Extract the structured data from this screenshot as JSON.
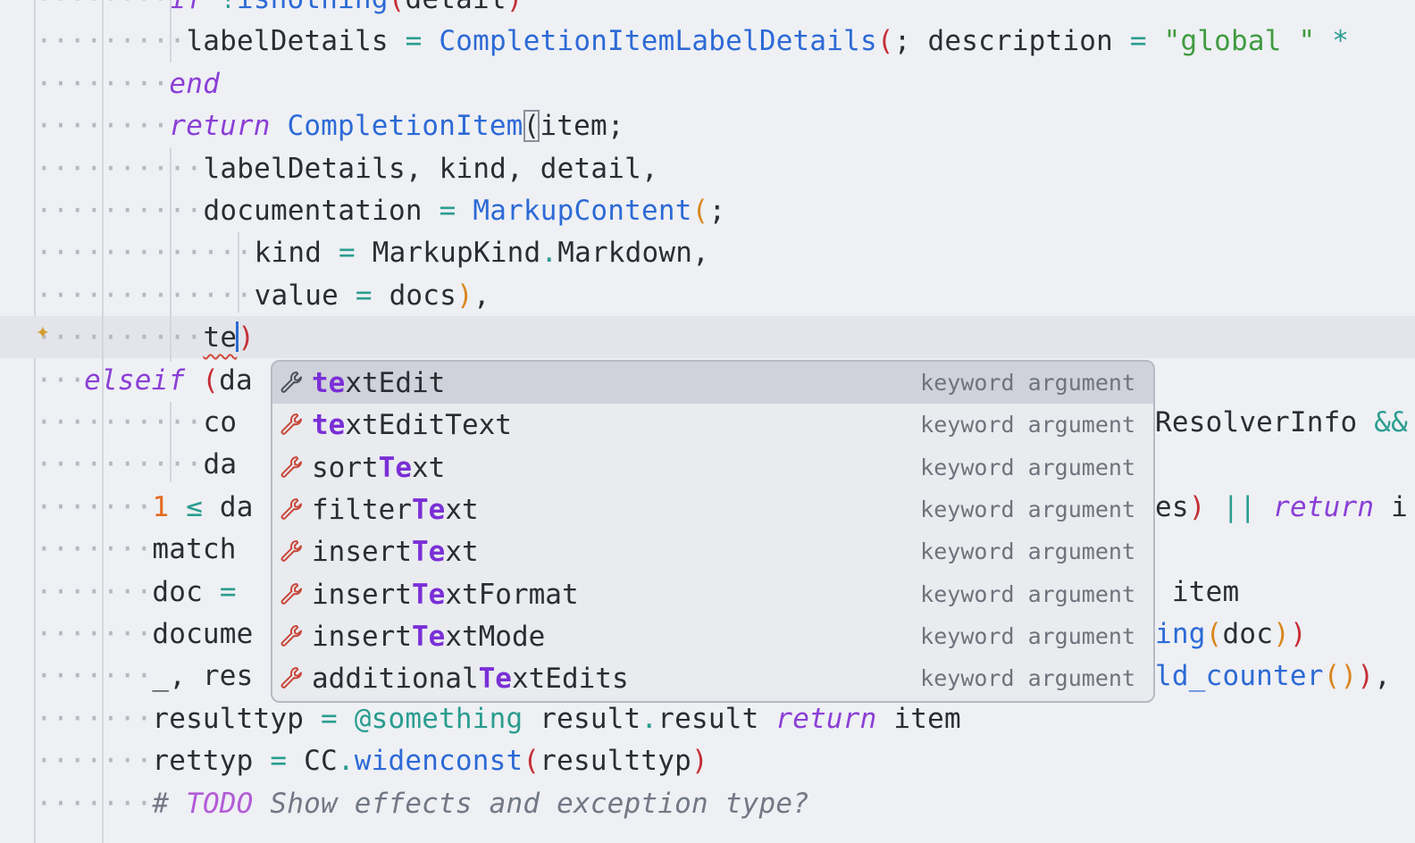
{
  "editor": {
    "lines": [
      {
        "ws": "········",
        "segs": [
          [
            "k",
            "if"
          ],
          [
            "t",
            " "
          ],
          [
            "o",
            "!"
          ],
          [
            "f",
            "isnothing"
          ],
          [
            "p1",
            "("
          ],
          [
            "t",
            "detail"
          ],
          [
            "p1",
            ")"
          ]
        ]
      },
      {
        "ws": "·········",
        "segs": [
          [
            "t",
            "labelDetails "
          ],
          [
            "o",
            "="
          ],
          [
            "t",
            " "
          ],
          [
            "f",
            "CompletionItemLabelDetails"
          ],
          [
            "p1",
            "("
          ],
          [
            "t",
            "; description "
          ],
          [
            "o",
            "="
          ],
          [
            "t",
            " "
          ],
          [
            "s",
            "\"global \""
          ],
          [
            "t",
            " "
          ],
          [
            "o",
            "*"
          ]
        ]
      },
      {
        "ws": "········",
        "segs": [
          [
            "k",
            "end"
          ]
        ]
      },
      {
        "ws": "········",
        "segs": [
          [
            "k",
            "return"
          ],
          [
            "t",
            " "
          ],
          [
            "f",
            "CompletionItem"
          ],
          [
            "pm",
            "("
          ],
          [
            "t",
            "item;"
          ]
        ]
      },
      {
        "ws": "··········",
        "segs": [
          [
            "t",
            "labelDetails, kind, detail,"
          ]
        ]
      },
      {
        "ws": "··········",
        "segs": [
          [
            "t",
            "documentation "
          ],
          [
            "o",
            "="
          ],
          [
            "t",
            " "
          ],
          [
            "f",
            "MarkupContent"
          ],
          [
            "p2",
            "("
          ],
          [
            "t",
            ";"
          ]
        ]
      },
      {
        "ws": "·············",
        "segs": [
          [
            "t",
            "kind "
          ],
          [
            "o",
            "="
          ],
          [
            "t",
            " MarkupKind"
          ],
          [
            "o",
            "."
          ],
          [
            "t",
            "Markdown,"
          ]
        ]
      },
      {
        "ws": "·············",
        "segs": [
          [
            "t",
            "value "
          ],
          [
            "o",
            "="
          ],
          [
            "t",
            " docs"
          ],
          [
            "p2",
            ")"
          ],
          [
            "t",
            ","
          ]
        ]
      },
      {
        "ws": "··········",
        "segs": [
          [
            "sq",
            "te"
          ],
          [
            "cur",
            ""
          ],
          [
            "p1",
            ")"
          ]
        ]
      },
      {
        "ws": "···",
        "segs": [
          [
            "k",
            "elseif"
          ],
          [
            "t",
            " "
          ],
          [
            "p1",
            "("
          ],
          [
            "t",
            "da"
          ]
        ]
      },
      {
        "ws": "··········",
        "segs": [
          [
            "t",
            "co"
          ]
        ]
      },
      {
        "ws": "··········",
        "segs": [
          [
            "t",
            "da"
          ]
        ]
      },
      {
        "ws": "·······",
        "segs": [
          [
            "n",
            "1"
          ],
          [
            "t",
            " "
          ],
          [
            "o",
            "≤"
          ],
          [
            "t",
            " da"
          ]
        ]
      },
      {
        "ws": "·······",
        "segs": [
          [
            "t",
            "match"
          ]
        ]
      },
      {
        "ws": "·······",
        "segs": [
          [
            "t",
            "doc "
          ],
          [
            "o",
            "="
          ]
        ]
      },
      {
        "ws": "·······",
        "segs": [
          [
            "t",
            "docume"
          ]
        ]
      },
      {
        "ws": "·······",
        "segs": [
          [
            "t",
            "_, res"
          ]
        ]
      },
      {
        "ws": "·······",
        "segs": [
          [
            "t",
            "resulttyp "
          ],
          [
            "o",
            "="
          ],
          [
            "t",
            " "
          ],
          [
            "o",
            "@something"
          ],
          [
            "t",
            " result"
          ],
          [
            "o",
            "."
          ],
          [
            "t",
            "result "
          ],
          [
            "k",
            "return"
          ],
          [
            "t",
            " item"
          ]
        ]
      },
      {
        "ws": "·······",
        "segs": [
          [
            "t",
            "rettyp "
          ],
          [
            "o",
            "="
          ],
          [
            "t",
            " CC"
          ],
          [
            "o",
            "."
          ],
          [
            "f",
            "widenconst"
          ],
          [
            "p1",
            "("
          ],
          [
            "t",
            "resulttyp"
          ],
          [
            "p1",
            ")"
          ]
        ]
      },
      {
        "ws": "·······",
        "segs": [
          [
            "c",
            "# "
          ],
          [
            "todo",
            "TODO"
          ],
          [
            "c",
            " Show effects and exception type?"
          ]
        ]
      }
    ],
    "right_overflow": {
      "line_10": [
        [
          "t",
          "ResolverInfo "
        ],
        [
          "o",
          "&&"
        ]
      ],
      "line_12": [
        [
          "t",
          "es"
        ],
        [
          "p1",
          ")"
        ],
        [
          "t",
          " "
        ],
        [
          "o",
          "||"
        ],
        [
          "t",
          " "
        ],
        [
          "k",
          "return"
        ],
        [
          "t",
          " i"
        ]
      ],
      "line_14": [
        [
          "t",
          " item"
        ]
      ],
      "line_15": [
        [
          "f",
          "ing"
        ],
        [
          "p2",
          "("
        ],
        [
          "t",
          "doc"
        ],
        [
          "p2",
          ")"
        ],
        [
          "p1",
          ")"
        ]
      ],
      "line_16": [
        [
          "f",
          "ld_counter"
        ],
        [
          "p2",
          "("
        ],
        [
          "p2",
          ")"
        ],
        [
          "p1",
          ")"
        ],
        [
          "t",
          ","
        ]
      ]
    }
  },
  "completion": {
    "typed": "te",
    "items": [
      {
        "label_parts": [
          [
            "m",
            "te"
          ],
          [
            "t",
            "xtEdit"
          ]
        ],
        "detail": "keyword argument",
        "icon": "wrench-icon",
        "selected": true
      },
      {
        "label_parts": [
          [
            "m",
            "te"
          ],
          [
            "t",
            "xtEditText"
          ]
        ],
        "detail": "keyword argument",
        "icon": "wrench-icon"
      },
      {
        "label_parts": [
          [
            "t",
            "sort"
          ],
          [
            "m",
            "Te"
          ],
          [
            "t",
            "xt"
          ]
        ],
        "detail": "keyword argument",
        "icon": "wrench-icon"
      },
      {
        "label_parts": [
          [
            "t",
            "filter"
          ],
          [
            "m",
            "Te"
          ],
          [
            "t",
            "xt"
          ]
        ],
        "detail": "keyword argument",
        "icon": "wrench-icon"
      },
      {
        "label_parts": [
          [
            "t",
            "insert"
          ],
          [
            "m",
            "Te"
          ],
          [
            "t",
            "xt"
          ]
        ],
        "detail": "keyword argument",
        "icon": "wrench-icon"
      },
      {
        "label_parts": [
          [
            "t",
            "insert"
          ],
          [
            "m",
            "Te"
          ],
          [
            "t",
            "xtFormat"
          ]
        ],
        "detail": "keyword argument",
        "icon": "wrench-icon"
      },
      {
        "label_parts": [
          [
            "t",
            "insert"
          ],
          [
            "m",
            "Te"
          ],
          [
            "t",
            "xtMode"
          ]
        ],
        "detail": "keyword argument",
        "icon": "wrench-icon"
      },
      {
        "label_parts": [
          [
            "t",
            "additional"
          ],
          [
            "m",
            "Te"
          ],
          [
            "t",
            "xtEdits"
          ]
        ],
        "detail": "keyword argument",
        "icon": "wrench-icon"
      }
    ]
  },
  "gutter": {
    "ai_suggestion_icon": "sparkle-icon"
  },
  "colors": {
    "keyword": "#8b3fd6",
    "function": "#2d6ad6",
    "operator": "#2a9d8f",
    "string": "#3f9b3f",
    "match": "#7a2fd6",
    "icon": "#c8473a"
  }
}
